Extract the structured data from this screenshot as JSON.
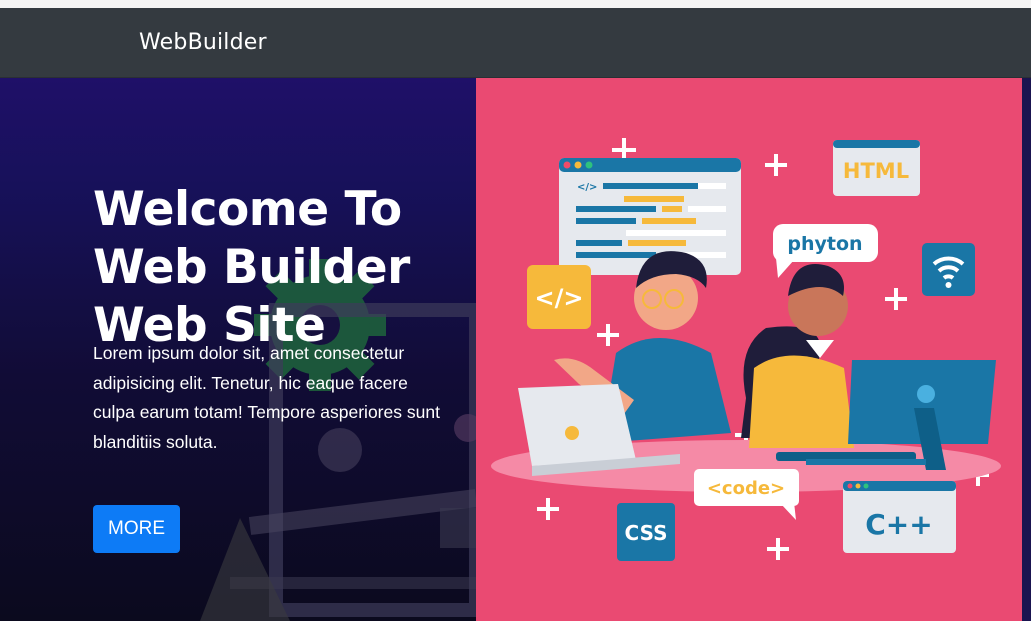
{
  "navbar": {
    "brand": "WebBuilder"
  },
  "hero": {
    "title_lines": [
      "Welcome To",
      "Web Builder",
      "Web Site"
    ],
    "description": "Lorem ipsum dolor sit, amet consectetur adipisicing elit. Tenetur, hic eaque facere culpa earum totam! Tempore asperiores sunt blanditiis soluta.",
    "button_label": "MORE"
  },
  "illustration": {
    "labels": {
      "html": "HTML",
      "phyton": "phyton",
      "code_tag": "</>",
      "code": "<code>",
      "css": "CSS",
      "cpp": "C++",
      "window_tag": "</>"
    }
  },
  "colors": {
    "navbar": "#343a40",
    "hero_left": "#1f1068",
    "hero_right": "#ea4a72",
    "button": "#0d7bf6"
  },
  "icons": [
    "gear-icon",
    "wifi-icon",
    "code-icon"
  ]
}
